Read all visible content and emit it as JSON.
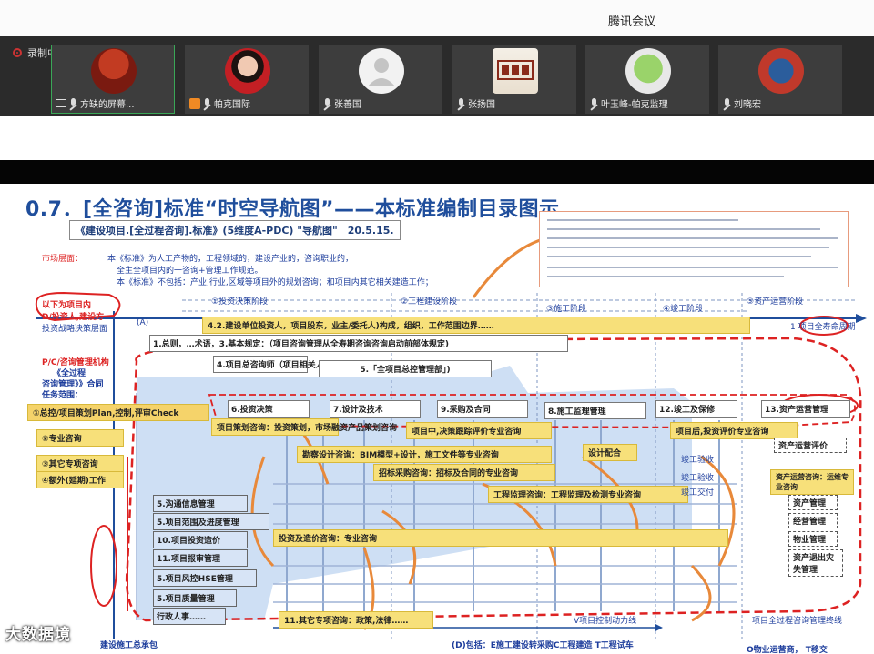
{
  "app": {
    "title": "腾讯会议"
  },
  "recording": {
    "label": "录制中"
  },
  "participants": [
    {
      "name": "方缺的屏幕...",
      "active": true,
      "host": false,
      "screen": true
    },
    {
      "name": "帕克国际",
      "active": false,
      "host": true,
      "screen": false
    },
    {
      "name": "张善国",
      "active": false,
      "host": false,
      "screen": false
    },
    {
      "name": "张扬国",
      "active": false,
      "host": false,
      "screen": false
    },
    {
      "name": "叶玉峰-帕克监理",
      "active": false,
      "host": false,
      "screen": false
    },
    {
      "name": "刘晓宏",
      "active": false,
      "host": false,
      "screen": false
    }
  ],
  "slide": {
    "title": "0.7．[全咨询]标准“时空导航图”——本标准编制目录图示",
    "subtitle": "《建设项目.[全过程咨询].标准》(5维度A-PDC) \"导航图\"　20.5.15.",
    "market_label": "市场层面：",
    "para1a": "本《标准》为人工产物的，工程领域的，建设产业的，咨询职业的，",
    "para1b": "全主全项目内的一咨询+管理工作规范。",
    "para2": "本《标准》不包括：产业,行业,区域等项目外的规划咨询；和项目内其它相关建造工作；",
    "left_red_1": "以下为项目内",
    "left_red_2": "D/投资人,建设方",
    "left_small": "投资战略决策层面",
    "left_red_3": "P/C/咨询管理机构",
    "left_blue_1": "《全过程",
    "left_blue_2": "咨询管理》》合同",
    "left_blue_3": "任务范围：",
    "axis_mark": "(A)",
    "axis_end": "1 项目全寿命周期",
    "phase_labels": [
      "①投资决策阶段",
      "②工程建设阶段",
      "③施工阶段",
      "④竣工阶段",
      "⑤资产运营阶段"
    ],
    "top_arrow": "4.2.建设单位投资人，项目股东，业主/委托人)构成，组织，工作范围边界……",
    "row_general": "1.总则，…术语，3.基本规定：（项目咨询管理从全寿期咨询咨询启动前部体规定)",
    "consultant_box": "4.项目总咨询师（项目相关人）",
    "pmo_box": "5.「全项目总控管理部」)",
    "left_items": [
      "①总控/项目策划Plan,控制,评审Check",
      "②专业咨询",
      "③其它专项咨询",
      "④额外(延期)工作"
    ],
    "phase_boxes": [
      "6.投资决策",
      "7.设计及技术",
      "9.采购及合同",
      "8.施工监理管理",
      "12.竣工及保修",
      "13.资产运营管理"
    ],
    "yellow_bands": [
      "项目策划咨询：投资策划，市场融资产品策划咨询",
      "项目中,决策跟踪评价专业咨询",
      "项目后,投资评价专业咨询",
      "勘察设计咨询：BIM模型+设计，施工文件等专业咨询",
      "设计配合",
      "招标采购咨询：招标及合同的专业咨询",
      "工程监理咨询：工程监理及检测专业咨询",
      "投资及造价咨询：专业咨询",
      "11.其它专项咨询：政策,法律……"
    ],
    "side_boxes": [
      "5.沟通信息管理",
      "5.项目范围及进度管理",
      "10.项目投资造价",
      "11.项目报审管理",
      "5.项目风控HSE管理",
      "5.项目质量管理",
      "行政人事……"
    ],
    "right_boxes": [
      "资产运营评价",
      "资产运营咨询：运维专业咨询",
      "资产管理",
      "经营管理",
      "物业管理",
      "资产退出灾失管理"
    ],
    "small_labels": [
      "竣工验收",
      "竣工验收",
      "竣工交付"
    ],
    "bottom_left": "建设施工总承包",
    "bottom_center": "(D)包括：E施工建设转采购C工程建造 T工程试车",
    "bottom_right_1": "项目全过程咨询管理终线",
    "bottom_right_2": "O物业运营商， T移交",
    "bottom_arrow_label": "V项目控制动力线"
  },
  "watermark": {
    "text": "大数据境"
  },
  "colors": {
    "accent_blue": "#1f4e9c",
    "alert_red": "#d22222",
    "highlight_yellow": "#f7e07a",
    "panel_blue": "#c9dbf3"
  }
}
